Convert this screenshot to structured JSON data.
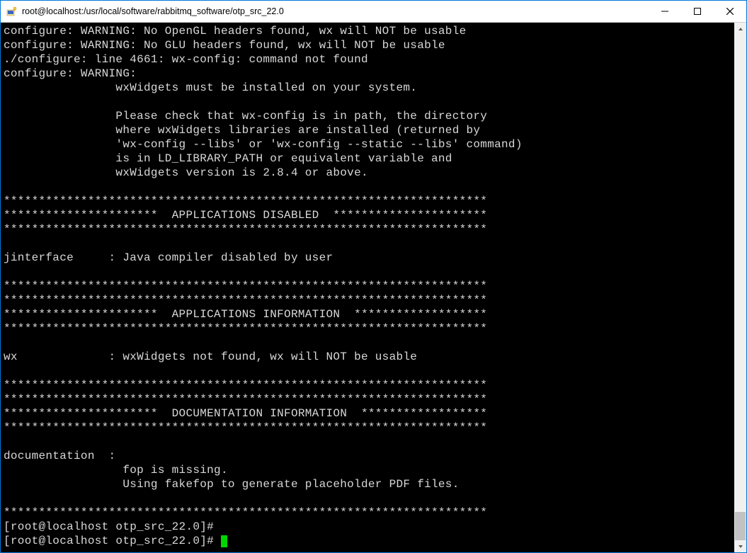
{
  "window": {
    "title": "root@localhost:/usr/local/software/rabbitmq_software/otp_src_22.0"
  },
  "terminal": {
    "lines": [
      "configure: WARNING: No OpenGL headers found, wx will NOT be usable",
      "configure: WARNING: No GLU headers found, wx will NOT be usable",
      "./configure: line 4661: wx-config: command not found",
      "configure: WARNING:",
      "                wxWidgets must be installed on your system.",
      "",
      "                Please check that wx-config is in path, the directory",
      "                where wxWidgets libraries are installed (returned by",
      "                'wx-config --libs' or 'wx-config --static --libs' command)",
      "                is in LD_LIBRARY_PATH or equivalent variable and",
      "                wxWidgets version is 2.8.4 or above.",
      "",
      "*********************************************************************",
      "**********************  APPLICATIONS DISABLED  **********************",
      "*********************************************************************",
      "",
      "jinterface     : Java compiler disabled by user",
      "",
      "*********************************************************************",
      "*********************************************************************",
      "**********************  APPLICATIONS INFORMATION  *******************",
      "*********************************************************************",
      "",
      "wx             : wxWidgets not found, wx will NOT be usable",
      "",
      "*********************************************************************",
      "*********************************************************************",
      "**********************  DOCUMENTATION INFORMATION  ******************",
      "*********************************************************************",
      "",
      "documentation  :",
      "                 fop is missing.",
      "                 Using fakefop to generate placeholder PDF files.",
      "",
      "*********************************************************************",
      "[root@localhost otp_src_22.0]# ",
      "[root@localhost otp_src_22.0]# "
    ]
  }
}
